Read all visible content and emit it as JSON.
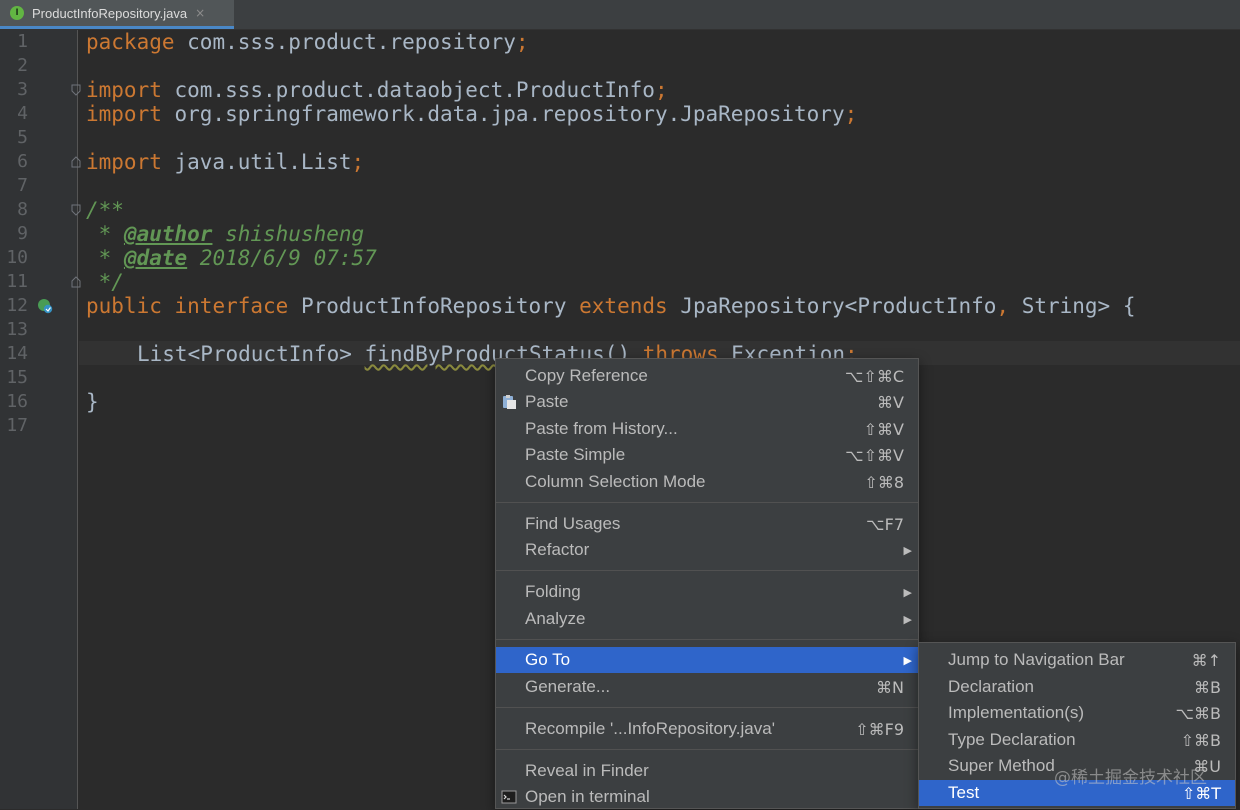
{
  "tab": {
    "icon_letter": "I",
    "label": "ProductInfoRepository.java",
    "close": "×"
  },
  "line_numbers": [
    "1",
    "2",
    "3",
    "4",
    "5",
    "6",
    "7",
    "8",
    "9",
    "10",
    "11",
    "12",
    "13",
    "14",
    "15",
    "16",
    "17"
  ],
  "code": {
    "l1_kw": "package",
    "l1_rest": " com.sss.product.repository",
    "semi": ";",
    "l3_kw": "import",
    "l3_rest": " com.sss.product.dataobject.ProductInfo",
    "l4_kw": "import",
    "l4_rest": " org.springframework.data.jpa.repository.JpaRepository",
    "l6_kw": "import",
    "l6_rest": " java.util.List",
    "l8": "/**",
    "l9_pre": " * ",
    "l9_tag": "@author",
    "l9_rest": " shishusheng",
    "l10_pre": " * ",
    "l10_tag": "@date",
    "l10_rest": " 2018/6/9 07:57",
    "l11": " */",
    "l12_kw1": "public",
    "l12_kw2": "interface",
    "l12_name": "ProductInfoRepository",
    "l12_kw3": "extends",
    "l12_type": "JpaRepository<ProductInfo",
    "l12_comma": ",",
    "l12_rest": " String> {",
    "l14_type": "List<ProductInfo> ",
    "l14_fn": "findByProductStatus",
    "l14_paren": "() ",
    "l14_kw": "throws",
    "l14_rest": " Exception",
    "l16": "}"
  },
  "context_menu": {
    "items": [
      {
        "label": "Copy Reference",
        "shortcut": "⌥⇧⌘C"
      },
      {
        "label": "Paste",
        "shortcut": "⌘V"
      },
      {
        "label": "Paste from History...",
        "shortcut": "⇧⌘V"
      },
      {
        "label": "Paste Simple",
        "shortcut": "⌥⇧⌘V"
      },
      {
        "label": "Column Selection Mode",
        "shortcut": "⇧⌘8"
      },
      {
        "label": "Find Usages",
        "shortcut": "⌥F7"
      },
      {
        "label": "Refactor",
        "shortcut": ""
      },
      {
        "label": "Folding",
        "shortcut": ""
      },
      {
        "label": "Analyze",
        "shortcut": ""
      },
      {
        "label": "Go To",
        "shortcut": ""
      },
      {
        "label": "Generate...",
        "shortcut": "⌘N"
      },
      {
        "label": "Recompile '...InfoRepository.java'",
        "shortcut": "⇧⌘F9"
      },
      {
        "label": "Reveal in Finder",
        "shortcut": ""
      },
      {
        "label": "Open in terminal",
        "shortcut": ""
      }
    ],
    "submenu_arrow": "▶"
  },
  "goto_submenu": {
    "items": [
      {
        "label": "Jump to Navigation Bar",
        "shortcut": "⌘↑"
      },
      {
        "label": "Declaration",
        "shortcut": "⌘B"
      },
      {
        "label": "Implementation(s)",
        "shortcut": "⌥⌘B"
      },
      {
        "label": "Type Declaration",
        "shortcut": "⇧⌘B"
      },
      {
        "label": "Super Method",
        "shortcut": "⌘U"
      },
      {
        "label": "Test",
        "shortcut": "⇧⌘T"
      }
    ]
  },
  "watermark": "@稀土掘金技术社区",
  "colors": {
    "selection": "#2f65ca",
    "keyword": "#cc7832",
    "doc": "#629755",
    "text": "#a9b7c6"
  }
}
